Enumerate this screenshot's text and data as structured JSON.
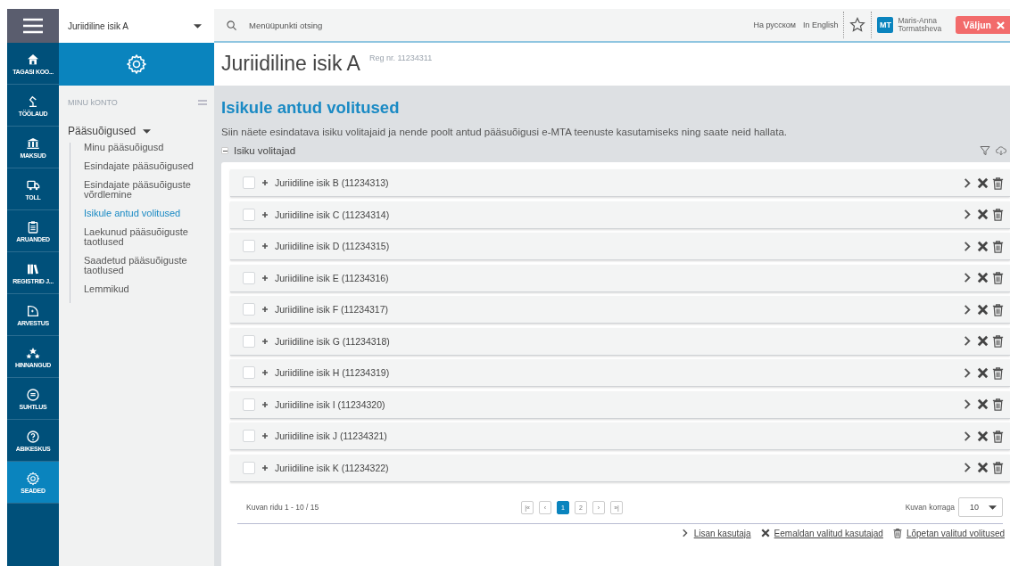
{
  "rail": {
    "items": [
      {
        "label": "TAGASI KOO...",
        "selected": false
      },
      {
        "label": "TÖÖLAUD",
        "selected": false
      },
      {
        "label": "MAKSUD",
        "selected": false
      },
      {
        "label": "TOLL",
        "selected": false
      },
      {
        "label": "ARUANDED",
        "selected": false
      },
      {
        "label": "REGISTRID J...",
        "selected": false
      },
      {
        "label": "ARVESTUS",
        "selected": false
      },
      {
        "label": "HINNANGUD",
        "selected": false
      },
      {
        "label": "SUHTLUS",
        "selected": false
      },
      {
        "label": "ABIKESKUS",
        "selected": false
      },
      {
        "label": "SEADED",
        "selected": true
      }
    ]
  },
  "entity_select": {
    "value": "Juriidiline isik A"
  },
  "sidebar": {
    "heading": "MINU kONTO",
    "group": {
      "label": "Pääsuõigused",
      "expanded": true,
      "children": [
        {
          "label": "Minu pääsuõigusd",
          "selected": false
        },
        {
          "label": "Esindajate pääsuõigused",
          "selected": false
        },
        {
          "label": "Esindajate pääsuõiguste võrdlemine",
          "selected": false
        },
        {
          "label": "Isikule antud volitused",
          "selected": true
        },
        {
          "label": "Laekunud pääsuõiguste taotlused",
          "selected": false
        },
        {
          "label": "Saadetud pääsuõiguste taotlused",
          "selected": false
        },
        {
          "label": "Lemmikud",
          "selected": false
        }
      ]
    }
  },
  "topbar": {
    "search_placeholder": "Menüüpunkti otsing",
    "languages": [
      "На русском",
      "In English"
    ],
    "user": {
      "initials": "MT",
      "name": "Maris-Anna Tormatsheva"
    },
    "logout": "Väljun"
  },
  "page": {
    "title": "Juriidiline isik A",
    "reg": "Reg nr. 11234311"
  },
  "section": {
    "title": "Isikule antud volitused",
    "description": "Siin näete esindatava isiku volitajaid ja nende poolt antud pääsuõigusi e-MTA teenuste kasutamiseks ning saate neid hallata.",
    "panel_title": "Isiku volitajad",
    "panel_expanded": true
  },
  "rows": [
    {
      "label": "Juriidiline isik B (11234313)",
      "checked": false
    },
    {
      "label": "Juriidiline isik C (11234314)",
      "checked": false
    },
    {
      "label": "Juriidiline isik D (11234315)",
      "checked": false
    },
    {
      "label": "Juriidiline isik E (11234316)",
      "checked": false
    },
    {
      "label": "Juriidiline isik F (11234317)",
      "checked": false
    },
    {
      "label": "Juriidiline isik G (11234318)",
      "checked": false
    },
    {
      "label": "Juriidiline isik H (11234319)",
      "checked": false
    },
    {
      "label": "Juriidiline isik I (11234320)",
      "checked": false
    },
    {
      "label": "Juriidiline isik J (11234321)",
      "checked": false
    },
    {
      "label": "Juriidiline isik K (11234322)",
      "checked": false
    }
  ],
  "pagination": {
    "summary": "Kuvan ridu 1 - 10 / 15",
    "first": "|«",
    "prev": "‹",
    "pages": [
      {
        "label": "1",
        "selected": true
      },
      {
        "label": "2",
        "selected": false
      }
    ],
    "next": "›",
    "last": "»|",
    "per_page_label": "Kuvan korraga",
    "per_page": "10"
  },
  "actions": [
    {
      "kind": "add",
      "label": "Lisan kasutaja"
    },
    {
      "kind": "remove",
      "label": "Eemaldan valitud kasutajad"
    },
    {
      "kind": "end",
      "label": "Lõpetan valitud volitused"
    }
  ]
}
